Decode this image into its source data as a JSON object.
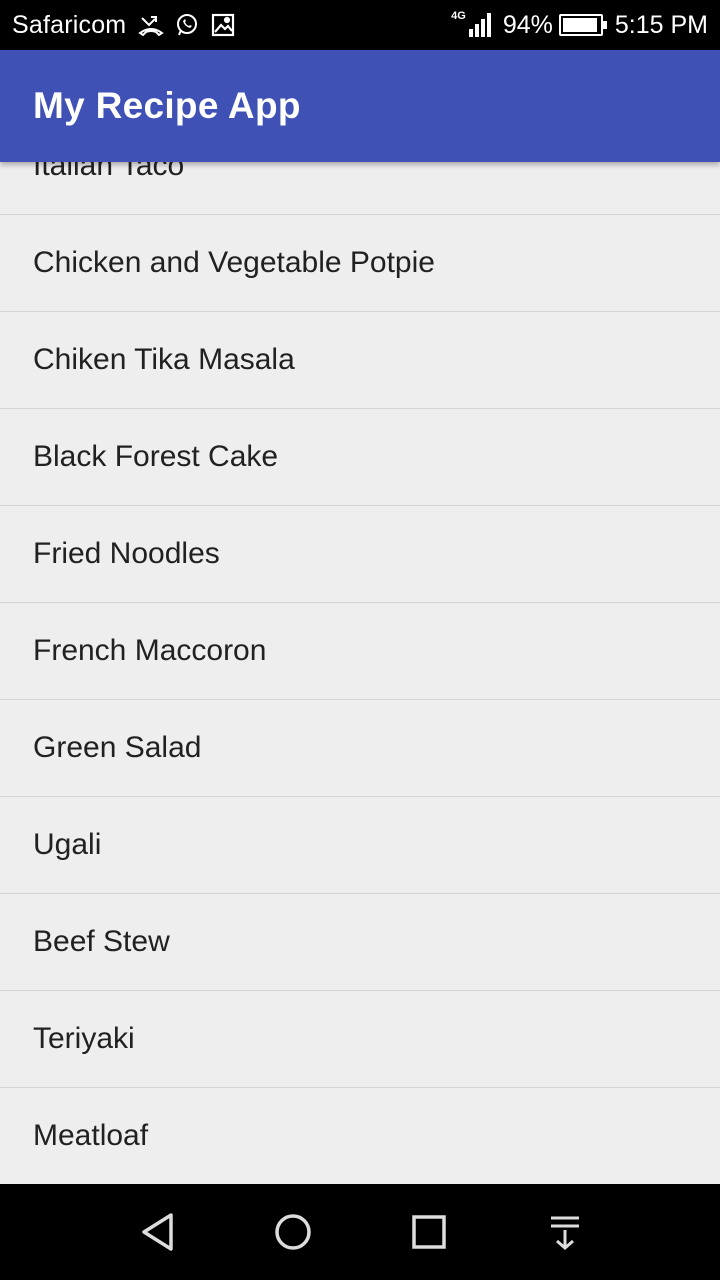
{
  "status_bar": {
    "carrier": "Safaricom",
    "network_type": "4G",
    "battery_percent": "94%",
    "battery_level": 0.94,
    "time": "5:15 PM",
    "icons": [
      "missed-call-icon",
      "whatsapp-icon",
      "image-icon"
    ]
  },
  "app_bar": {
    "title": "My Recipe App",
    "color": "#3f51b5"
  },
  "recipes": [
    "Itallan Taco",
    "Chicken and Vegetable Potpie",
    "Chiken Tika Masala",
    "Black Forest Cake",
    "Fried Noodles",
    "French Maccoron",
    "Green Salad",
    "Ugali",
    "Beef Stew",
    "Teriyaki",
    "Meatloaf"
  ],
  "nav_bar": {
    "buttons": [
      "back-icon",
      "home-icon",
      "recents-icon",
      "notification-pull-icon"
    ]
  }
}
